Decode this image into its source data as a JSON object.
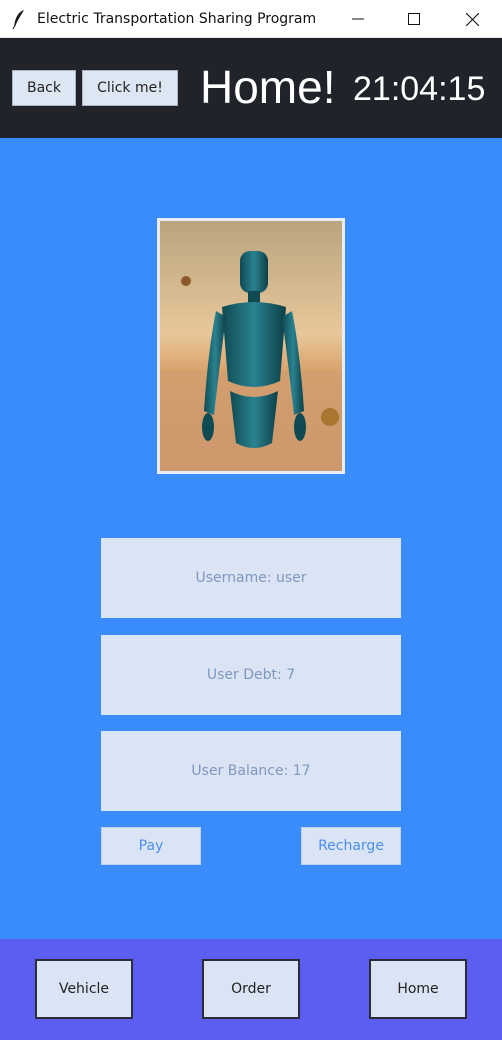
{
  "window": {
    "title": "Electric Transportation Sharing Program",
    "minimize_icon": "minimize-icon",
    "maximize_icon": "maximize-icon",
    "close_icon": "close-icon"
  },
  "header": {
    "back_label": "Back",
    "click_label": "Click me!",
    "page_title": "Home!",
    "clock": "21:04:15"
  },
  "profile": {
    "username": "Username: user",
    "debt": "User Debt: 7",
    "balance": "User Balance: 17",
    "pay_label": "Pay",
    "recharge_label": "Recharge"
  },
  "nav": {
    "vehicle_label": "Vehicle",
    "order_label": "Order",
    "home_label": "Home"
  },
  "colors": {
    "background": "#3a8cfd",
    "header": "#20242a",
    "bottom_bar": "#5b5ef0",
    "box": "#dae4f4"
  }
}
